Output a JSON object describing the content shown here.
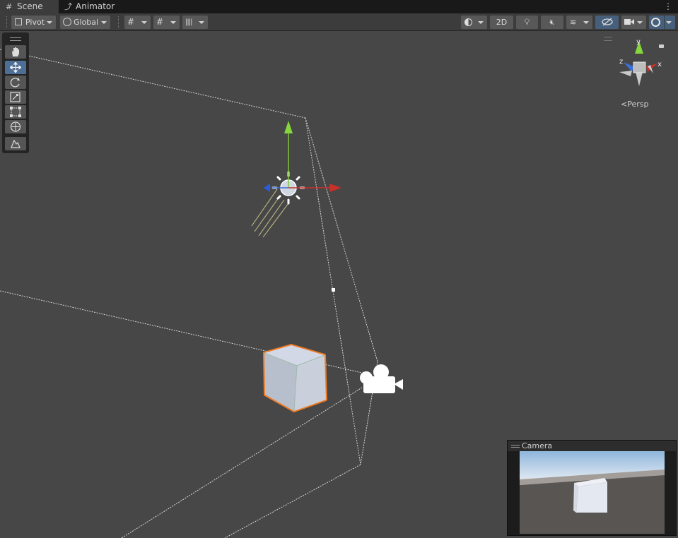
{
  "tabs": [
    {
      "label": "Scene",
      "icon": "grid-icon",
      "active": true
    },
    {
      "label": "Animator",
      "icon": "animator-icon",
      "active": false
    }
  ],
  "toolbar": {
    "pivot_label": "Pivot",
    "global_label": "Global",
    "mode_2d_label": "2D"
  },
  "gizmo": {
    "projection_label": "Persp",
    "axis_x": "x",
    "axis_y": "y",
    "axis_z": "z"
  },
  "camera_preview": {
    "title": "Camera"
  },
  "colors": {
    "background": "#474747",
    "toolbar": "#3c3c3c",
    "selection_outline": "#f07a22",
    "axis_x": "#c8302a",
    "axis_y": "#7ec73a",
    "axis_z": "#3a6fd8",
    "active_button": "#46607c"
  }
}
